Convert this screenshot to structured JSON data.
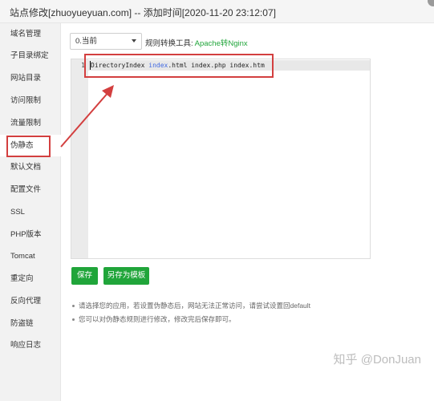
{
  "window": {
    "title": "站点修改[zhuoyueyuan.com] -- 添加时间[2020-11-20 23:12:07]"
  },
  "sidebar": {
    "items": [
      {
        "label": "域名管理"
      },
      {
        "label": "子目录绑定"
      },
      {
        "label": "网站目录"
      },
      {
        "label": "访问限制"
      },
      {
        "label": "流量限制"
      },
      {
        "label": "伪静态",
        "active": true
      },
      {
        "label": "默认文档"
      },
      {
        "label": "配置文件"
      },
      {
        "label": "SSL"
      },
      {
        "label": "PHP版本"
      },
      {
        "label": "Tomcat"
      },
      {
        "label": "重定向"
      },
      {
        "label": "反向代理"
      },
      {
        "label": "防盗链"
      },
      {
        "label": "响应日志"
      }
    ]
  },
  "toolbar": {
    "template_select_value": "0.当前",
    "rule_tool_label": "规则转换工具:",
    "rule_tool_link": "Apache转Nginx"
  },
  "editor": {
    "line_number": "1",
    "code_directive": "DirectoryIndex ",
    "code_keyword": "index",
    "code_rest": ".html index.php index.htm"
  },
  "actions": {
    "save_label": "保存",
    "save_as_template_label": "另存为模板"
  },
  "tips": [
    "请选择您的应用，若设置伪静态后，网站无法正常访问，请尝试设置回default",
    "您可以对伪静态规则进行修改，修改完后保存即可。"
  ],
  "watermark": "知乎 @DonJuan",
  "colors": {
    "accent_green": "#20a53a",
    "annotation_red": "#d33f3f",
    "code_keyword": "#4169e1"
  }
}
